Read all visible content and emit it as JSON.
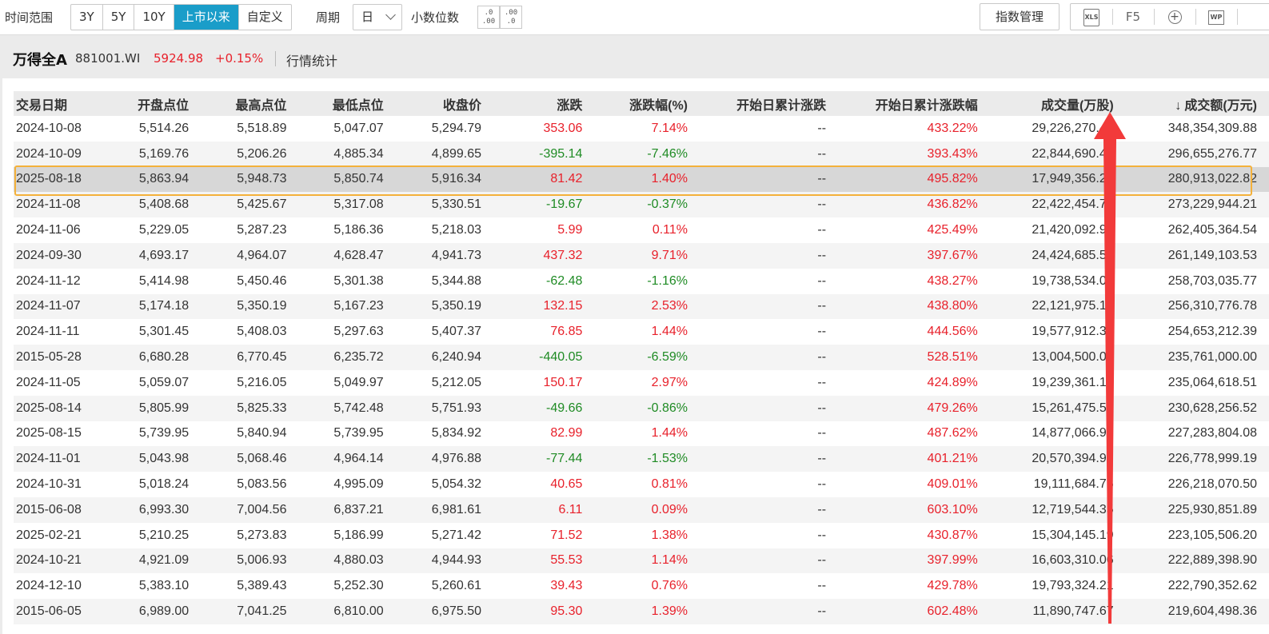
{
  "toolbar": {
    "range_label": "时间范围",
    "ranges": [
      "3Y",
      "5Y",
      "10Y",
      "上市以来",
      "自定义"
    ],
    "active_range": "上市以来",
    "period_label": "周期",
    "period_value": "日",
    "decimal_label": "小数位数",
    "dec_increase": ".0\n.00",
    "dec_decrease": ".00\n.0",
    "manage_label": "指数管理",
    "xls_label": "XLS",
    "f5_label": "F5",
    "wp_label": "WP"
  },
  "header": {
    "name": "万得全A",
    "code": "881001.WI",
    "price": "5924.98",
    "change": "+0.15%",
    "stats_link": "行情统计"
  },
  "table": {
    "columns": [
      "交易日期",
      "开盘点位",
      "最高点位",
      "最低点位",
      "收盘价",
      "涨跌",
      "涨跌幅(%)",
      "开始日累计涨跌",
      "开始日累计涨跌幅",
      "成交量(万股)",
      "成交额(万元)"
    ],
    "sort_indicator": "↓",
    "rows": [
      [
        "2024-10-08",
        "5,514.26",
        "5,518.89",
        "5,047.07",
        "5,294.79",
        "353.06",
        "7.14%",
        "--",
        "433.22%",
        "29,226,270.46",
        "348,354,309.88"
      ],
      [
        "2024-10-09",
        "5,169.76",
        "5,206.26",
        "4,885.34",
        "4,899.65",
        "-395.14",
        "-7.46%",
        "--",
        "393.43%",
        "22,844,690.48",
        "296,655,276.77"
      ],
      [
        "2025-08-18",
        "5,863.94",
        "5,948.73",
        "5,850.74",
        "5,916.34",
        "81.42",
        "1.40%",
        "--",
        "495.82%",
        "17,949,356.22",
        "280,913,022.82"
      ],
      [
        "2024-11-08",
        "5,408.68",
        "5,425.67",
        "5,317.08",
        "5,330.51",
        "-19.67",
        "-0.37%",
        "--",
        "436.82%",
        "22,422,454.71",
        "273,229,944.21"
      ],
      [
        "2024-11-06",
        "5,229.05",
        "5,287.23",
        "5,186.36",
        "5,218.03",
        "5.99",
        "0.11%",
        "--",
        "425.49%",
        "21,420,092.94",
        "262,405,364.54"
      ],
      [
        "2024-09-30",
        "4,693.17",
        "4,964.07",
        "4,628.47",
        "4,941.73",
        "437.32",
        "9.71%",
        "--",
        "397.67%",
        "24,424,685.52",
        "261,149,103.53"
      ],
      [
        "2024-11-12",
        "5,414.98",
        "5,450.46",
        "5,301.38",
        "5,344.88",
        "-62.48",
        "-1.16%",
        "--",
        "438.27%",
        "19,738,534.00",
        "258,703,035.77"
      ],
      [
        "2024-11-07",
        "5,174.18",
        "5,350.19",
        "5,167.23",
        "5,350.19",
        "132.15",
        "2.53%",
        "--",
        "438.80%",
        "22,121,975.16",
        "256,310,776.78"
      ],
      [
        "2024-11-11",
        "5,301.45",
        "5,408.03",
        "5,297.63",
        "5,407.37",
        "76.85",
        "1.44%",
        "--",
        "444.56%",
        "19,577,912.31",
        "254,653,212.39"
      ],
      [
        "2015-05-28",
        "6,680.28",
        "6,770.45",
        "6,235.72",
        "6,240.94",
        "-440.05",
        "-6.59%",
        "--",
        "528.51%",
        "13,004,500.00",
        "235,761,000.00"
      ],
      [
        "2024-11-05",
        "5,059.07",
        "5,216.05",
        "5,049.97",
        "5,212.05",
        "150.17",
        "2.97%",
        "--",
        "424.89%",
        "19,239,361.16",
        "235,064,618.51"
      ],
      [
        "2025-08-14",
        "5,805.99",
        "5,825.33",
        "5,742.48",
        "5,751.93",
        "-49.66",
        "-0.86%",
        "--",
        "479.26%",
        "15,261,475.57",
        "230,628,256.52"
      ],
      [
        "2025-08-15",
        "5,739.95",
        "5,840.94",
        "5,739.95",
        "5,834.92",
        "82.99",
        "1.44%",
        "--",
        "487.62%",
        "14,877,066.99",
        "227,283,804.08"
      ],
      [
        "2024-11-01",
        "5,043.98",
        "5,068.46",
        "4,964.14",
        "4,976.88",
        "-77.44",
        "-1.53%",
        "--",
        "401.21%",
        "20,570,394.91",
        "226,778,999.19"
      ],
      [
        "2024-10-31",
        "5,018.24",
        "5,083.56",
        "4,995.09",
        "5,054.32",
        "40.65",
        "0.81%",
        "--",
        "409.01%",
        "19,111,684.76",
        "226,218,070.50"
      ],
      [
        "2015-06-08",
        "6,993.30",
        "7,004.56",
        "6,837.21",
        "6,981.61",
        "6.11",
        "0.09%",
        "--",
        "603.10%",
        "12,719,544.35",
        "225,930,851.89"
      ],
      [
        "2025-02-21",
        "5,210.25",
        "5,273.83",
        "5,186.99",
        "5,271.42",
        "71.52",
        "1.38%",
        "--",
        "430.87%",
        "15,304,145.19",
        "223,105,506.20"
      ],
      [
        "2024-10-21",
        "4,921.09",
        "5,006.93",
        "4,880.03",
        "4,944.93",
        "55.53",
        "1.14%",
        "--",
        "397.99%",
        "16,603,310.06",
        "222,889,398.90"
      ],
      [
        "2024-12-10",
        "5,383.10",
        "5,389.43",
        "5,252.30",
        "5,260.61",
        "39.43",
        "0.76%",
        "--",
        "429.78%",
        "19,793,324.21",
        "222,790,352.62"
      ],
      [
        "2015-06-05",
        "6,989.00",
        "7,041.25",
        "6,810.00",
        "6,975.50",
        "95.30",
        "1.39%",
        "--",
        "602.48%",
        "11,890,747.67",
        "219,604,498.36"
      ]
    ],
    "selected_row": 2
  },
  "colors": {
    "accent": "#1a9dc9",
    "up": "#e8212b",
    "down": "#1f8b24",
    "highlight": "#f4b13a",
    "annotation_arrow": "#f23a3a"
  }
}
